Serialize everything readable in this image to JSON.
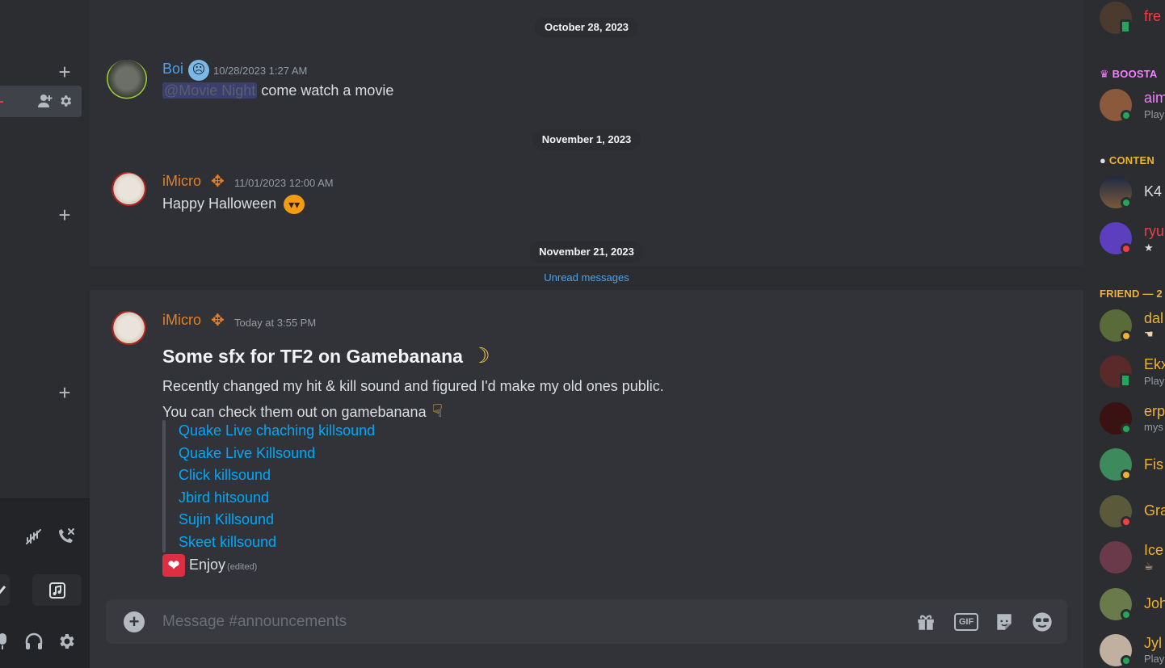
{
  "colors": {
    "chat_bg": "#313338",
    "sidebar_bg": "#2b2d31",
    "link": "#00a8fc",
    "unread": "#4ea1ee",
    "boi_name": "#4ea1ee",
    "imicro_name": "#e67e22",
    "status_online": "#23a55a",
    "status_dnd": "#f23f43",
    "status_idle": "#f0b232"
  },
  "dividers": {
    "d1": "October 28, 2023",
    "d2": "November 1, 2023",
    "d3": "November 21, 2023"
  },
  "unread_label": "Unread messages",
  "messages": [
    {
      "author": "Boi",
      "badge_icon": "cold-face-emoji",
      "timestamp": "10/28/2023 1:27 AM",
      "mention": "@Movie Night",
      "text": "come watch a movie"
    },
    {
      "author": "iMicro",
      "badge_icon": "maple-leaf-emoji",
      "timestamp": "11/01/2023 12:00 AM",
      "text": "Happy Halloween",
      "emoji": "🎃"
    },
    {
      "author": "iMicro",
      "badge_icon": "maple-leaf-emoji",
      "timestamp": "Today at 3:55 PM",
      "heading": "Some sfx for TF2 on Gamebanana",
      "heading_emoji": "🍌",
      "line1": "Recently changed my hit & kill sound and figured I'd make my old ones public.",
      "line2": "You can check them out on gamebanana",
      "line2_emoji": "👇",
      "links": [
        "Quake Live chaching killsound",
        "Quake Live Killsound",
        "Click killsound",
        "Jbird hitsound",
        "Sujin Killsound",
        "Skeet killsound"
      ],
      "closing": "Enjoy",
      "closing_emoji": "❤",
      "edited": "(edited)"
    }
  ],
  "composer": {
    "placeholder": "Message #announcements",
    "gif_label": "GIF"
  },
  "members": {
    "top_partial": {
      "name": "fre"
    },
    "sections": [
      {
        "title": "BOOSTA",
        "color": "#f47fff"
      },
      {
        "title": "CONTEN",
        "color": "#f0b232"
      },
      {
        "title": "FRIEND — 2",
        "color": "#f0b232"
      }
    ],
    "items": [
      {
        "name": "aim",
        "sub": "Play",
        "color": "#f47fff"
      },
      {
        "name": "K4",
        "sub": "",
        "color": "#dbdee1"
      },
      {
        "name": "ryu",
        "sub": "",
        "color": "#f23f43"
      },
      {
        "name": "dal",
        "sub": "",
        "color": "#f0b232"
      },
      {
        "name": "Ekx",
        "sub": "Play",
        "color": "#f0b232"
      },
      {
        "name": "erp",
        "sub": "mys",
        "color": "#f0b232"
      },
      {
        "name": "Fis",
        "sub": "",
        "color": "#f0b232"
      },
      {
        "name": "Gra",
        "sub": "",
        "color": "#f0b232"
      },
      {
        "name": "Ice",
        "sub": "",
        "color": "#f0b232"
      },
      {
        "name": "Joh",
        "sub": "",
        "color": "#f0b232"
      },
      {
        "name": "Jyl",
        "sub": "Play",
        "color": "#f0b232"
      }
    ]
  }
}
